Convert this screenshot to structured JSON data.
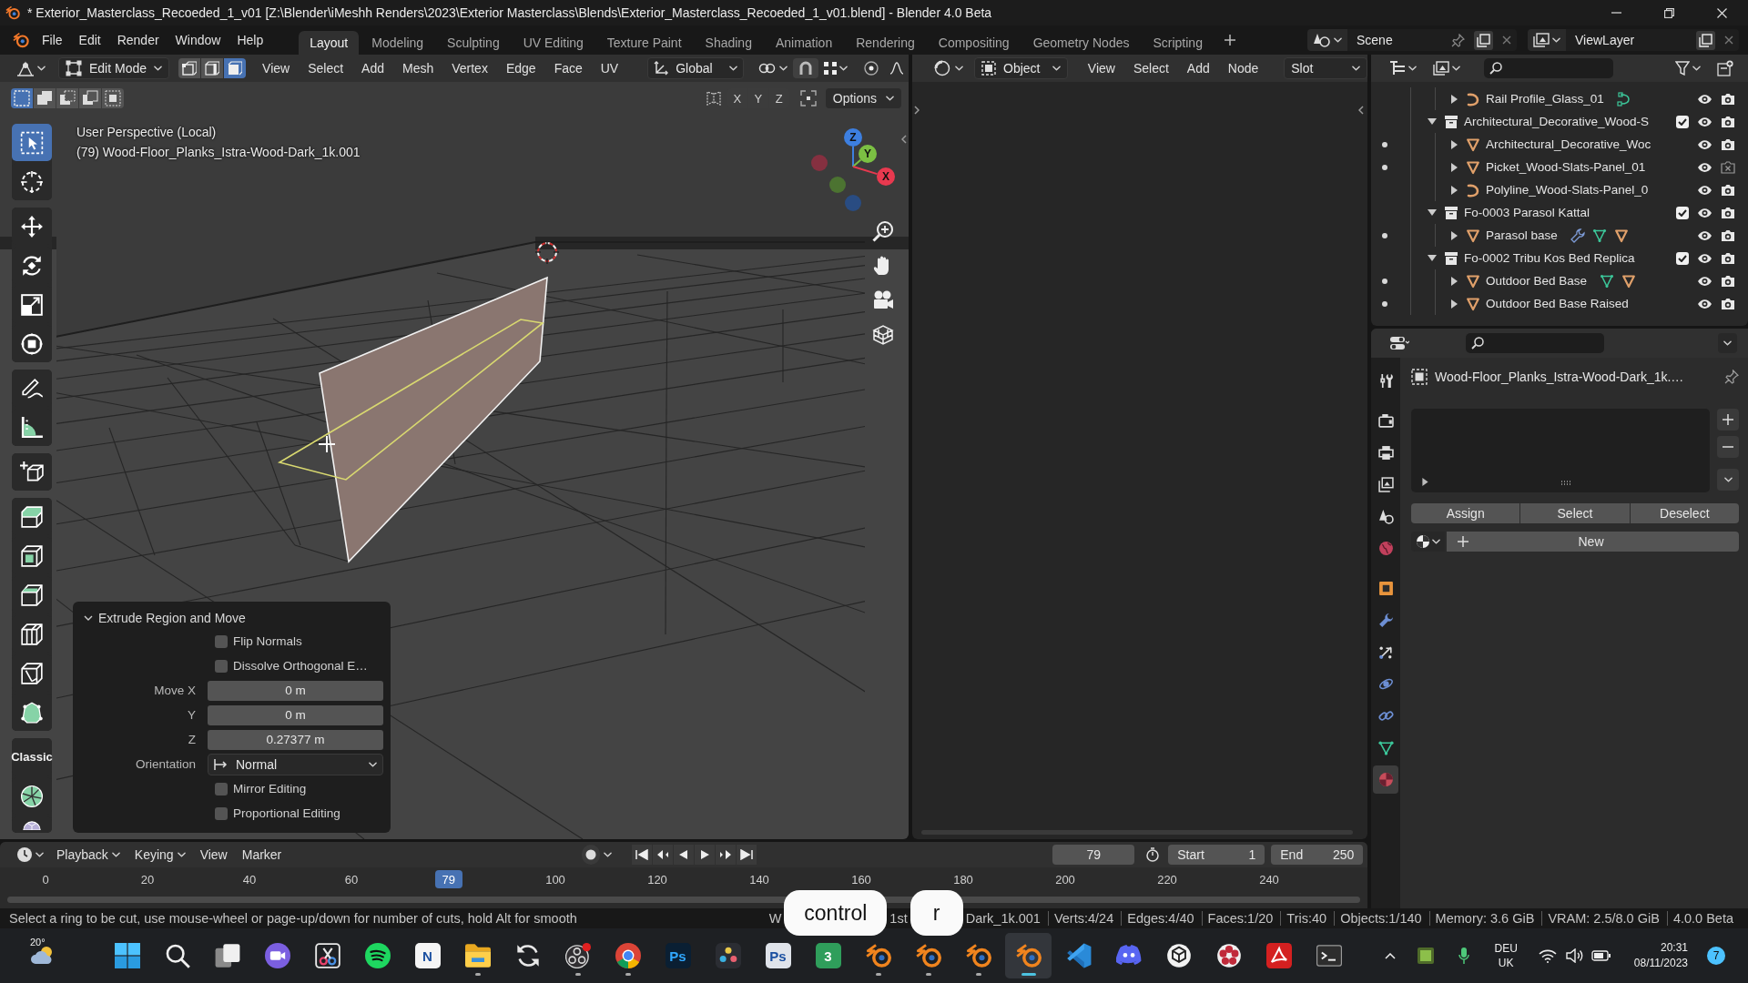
{
  "title_bar": {
    "title": "* Exterior_Masterclass_Recoeded_1_v01 [Z:\\Blender\\iMeshh Renders\\2023\\Exterior Masterclass\\Blends\\Exterior_Masterclass_Recoeded_1_v01.blend] - Blender 4.0 Beta"
  },
  "top_bar": {
    "menus": [
      "File",
      "Edit",
      "Render",
      "Window",
      "Help"
    ],
    "workspaces": [
      {
        "label": "Layout",
        "selected": true
      },
      {
        "label": "Modeling",
        "selected": false
      },
      {
        "label": "Sculpting",
        "selected": false
      },
      {
        "label": "UV Editing",
        "selected": false
      },
      {
        "label": "Texture Paint",
        "selected": false
      },
      {
        "label": "Shading",
        "selected": false
      },
      {
        "label": "Animation",
        "selected": false
      },
      {
        "label": "Rendering",
        "selected": false
      },
      {
        "label": "Compositing",
        "selected": false
      },
      {
        "label": "Geometry Nodes",
        "selected": false
      },
      {
        "label": "Scripting",
        "selected": false
      }
    ],
    "scene": "Scene",
    "view_layer": "ViewLayer"
  },
  "viewport": {
    "header": {
      "mode": "Edit Mode",
      "select_modes": [
        {
          "kind": "vertex",
          "selected": false
        },
        {
          "kind": "edge",
          "selected": false
        },
        {
          "kind": "face",
          "selected": true
        }
      ],
      "menus": [
        "View",
        "Select",
        "Add",
        "Mesh",
        "Vertex",
        "Edge",
        "Face",
        "UV"
      ],
      "orientation": "Global"
    },
    "tool_settings": {
      "box_modes": [
        {
          "kind": "set",
          "selected": true
        },
        {
          "kind": "extend",
          "selected": false
        },
        {
          "kind": "subtract",
          "selected": false
        },
        {
          "kind": "difference",
          "selected": false
        },
        {
          "kind": "intersect",
          "selected": false
        }
      ],
      "mirror_axes": [
        "X",
        "Y",
        "Z"
      ],
      "options": "Options"
    },
    "info": [
      "User Perspective (Local)",
      "(79) Wood-Floor_Planks_Istra-Wood-Dark_1k.001"
    ],
    "tool_groups": [
      [
        {
          "kind": "select",
          "selected": true
        },
        {
          "kind": "cursor",
          "selected": false
        }
      ],
      [
        {
          "kind": "move",
          "selected": false
        },
        {
          "kind": "rotate",
          "selected": false
        },
        {
          "kind": "scale",
          "selected": false
        },
        {
          "kind": "transform",
          "selected": false
        }
      ],
      [
        {
          "kind": "annotate",
          "selected": false
        },
        {
          "kind": "measure",
          "selected": false
        }
      ],
      [
        {
          "kind": "add_cube",
          "selected": false
        }
      ],
      [
        {
          "kind": "extrude",
          "selected": false
        },
        {
          "kind": "inset",
          "selected": false
        },
        {
          "kind": "bevel",
          "selected": false
        },
        {
          "kind": "loop_cut",
          "selected": false
        },
        {
          "kind": "knife",
          "selected": false
        },
        {
          "kind": "poly_build",
          "selected": false
        }
      ],
      [
        {
          "kind": "fast_loop",
          "label": "Classic",
          "selected": false
        },
        {
          "kind": "spin",
          "selected": false
        },
        {
          "kind": "smooth",
          "selected": false
        }
      ]
    ],
    "gizmo": [
      {
        "kind": "z",
        "label": "Z"
      },
      {
        "kind": "y",
        "label": "Y"
      },
      {
        "kind": "x",
        "label": "X"
      }
    ],
    "operator_panel": {
      "title": "Extrude Region and Move",
      "expanded": true,
      "fields": [
        {
          "kind": "checkbox",
          "label": "Flip Normals",
          "checked": false
        },
        {
          "kind": "checkbox",
          "label": "Dissolve Orthogonal E…",
          "checked": false
        },
        {
          "kind": "number",
          "label": "Move X",
          "value": "0 m"
        },
        {
          "kind": "number",
          "label": "Y",
          "value": "0 m"
        },
        {
          "kind": "number",
          "label": "Z",
          "value": "0.27377 m"
        },
        {
          "kind": "dropdown",
          "label": "Orientation",
          "value": "Normal"
        },
        {
          "kind": "checkbox",
          "label": "Mirror Editing",
          "checked": false
        },
        {
          "kind": "checkbox",
          "label": "Proportional Editing",
          "checked": false
        }
      ]
    }
  },
  "shader_editor": {
    "object_type": "Object",
    "menus": [
      "View",
      "Select",
      "Add",
      "Node"
    ],
    "slot": "Slot"
  },
  "outliner": {
    "tree": [
      {
        "kind": "continued",
        "children": [
          {
            "kind": "curve",
            "name": "Rail Profile_Glass_01",
            "expanded": false,
            "mode_dot": false,
            "visible": true,
            "render": true,
            "extras": [
              {
                "kind": "curve_data"
              }
            ]
          }
        ]
      },
      {
        "kind": "collection",
        "name": "Architectural_Decorative_Wood-S",
        "expanded": true,
        "checked": true,
        "visible": true,
        "render": true,
        "children": [
          {
            "kind": "mesh",
            "name": "Architectural_Decorative_Woc",
            "expanded": false,
            "mode_dot": true,
            "visible": true,
            "render": true
          },
          {
            "kind": "mesh",
            "name": "Picket_Wood-Slats-Panel_01",
            "expanded": false,
            "mode_dot": true,
            "visible": true,
            "render": false
          },
          {
            "kind": "curve",
            "name": "Polyline_Wood-Slats-Panel_0",
            "expanded": false,
            "mode_dot": false,
            "visible": true,
            "render": true
          }
        ]
      },
      {
        "kind": "collection",
        "name": "Fo-0003 Parasol Kattal",
        "expanded": true,
        "checked": true,
        "visible": true,
        "render": true,
        "children": [
          {
            "kind": "mesh",
            "name": "Parasol base",
            "expanded": false,
            "mode_dot": true,
            "visible": true,
            "render": true,
            "extras": [
              {
                "kind": "modifier"
              },
              {
                "kind": "mesh_data"
              },
              {
                "kind": "material"
              }
            ]
          }
        ]
      },
      {
        "kind": "collection",
        "name": "Fo-0002 Tribu Kos Bed Replica",
        "expanded": true,
        "checked": true,
        "visible": true,
        "render": true,
        "children": [
          {
            "kind": "mesh",
            "name": "Outdoor Bed Base",
            "expanded": false,
            "mode_dot": true,
            "visible": true,
            "render": true,
            "extras": [
              {
                "kind": "mesh_data"
              },
              {
                "kind": "material"
              }
            ]
          },
          {
            "kind": "mesh",
            "name": "Outdoor Bed Base Raised",
            "expanded": false,
            "mode_dot": true,
            "visible": true,
            "render": true
          }
        ]
      }
    ]
  },
  "properties": {
    "tabs": [
      {
        "kind": "tool",
        "selected": false
      },
      {
        "kind": "render",
        "selected": false
      },
      {
        "kind": "output",
        "selected": false
      },
      {
        "kind": "view_layer",
        "selected": false
      },
      {
        "kind": "scene",
        "selected": false
      },
      {
        "kind": "world",
        "selected": false
      },
      {
        "kind": "object",
        "selected": false
      },
      {
        "kind": "modifiers",
        "selected": false
      },
      {
        "kind": "particles",
        "selected": false
      },
      {
        "kind": "physics",
        "selected": false
      },
      {
        "kind": "constraints",
        "selected": false
      },
      {
        "kind": "data",
        "selected": false
      },
      {
        "kind": "material",
        "selected": true
      }
    ],
    "object_name": "Wood-Floor_Planks_Istra-Wood-Dark_1k.…",
    "slot_buttons": [
      "Assign",
      "Select",
      "Deselect"
    ],
    "new_material": "New"
  },
  "timeline": {
    "menus": [
      {
        "label": "Playback",
        "dropdown": true
      },
      {
        "label": "Keying",
        "dropdown": true
      },
      {
        "label": "View",
        "dropdown": false
      },
      {
        "label": "Marker",
        "dropdown": false
      }
    ],
    "current_frame": "79",
    "start": {
      "label": "Start",
      "value": "1"
    },
    "end": {
      "label": "End",
      "value": "250"
    },
    "ticks": [
      "0",
      "20",
      "40",
      "60",
      "100",
      "120",
      "140",
      "160",
      "180",
      "200",
      "220",
      "240"
    ],
    "playhead": {
      "label": "79",
      "level": 0.328
    }
  },
  "status_bar": {
    "hint": "Select a ring to be cut, use mouse-wheel or page-up/down for number of cuts, hold Alt for smooth",
    "items": [
      {
        "kind": "fragment",
        "text": "W"
      },
      {
        "kind": "key",
        "text": "control"
      },
      {
        "kind": "fragment",
        "text": "1st"
      },
      {
        "kind": "key",
        "text": "r"
      },
      {
        "kind": "fragment",
        "text": "Dark_1k.001"
      },
      {
        "kind": "stat",
        "text": "Verts:4/24"
      },
      {
        "kind": "stat",
        "text": "Edges:4/40"
      },
      {
        "kind": "stat",
        "text": "Faces:1/20"
      },
      {
        "kind": "stat",
        "text": "Tris:40"
      },
      {
        "kind": "stat",
        "text": "Objects:1/140"
      },
      {
        "kind": "stat",
        "text": "Memory: 3.6 GiB"
      },
      {
        "kind": "stat",
        "text": "VRAM: 2.5/8.0 GiB"
      },
      {
        "kind": "stat",
        "text": "4.0.0 Beta"
      }
    ]
  },
  "taskbar": {
    "weather": "20°",
    "apps": [
      {
        "kind": "start",
        "running": false,
        "selected": false
      },
      {
        "kind": "search",
        "running": false,
        "selected": false
      },
      {
        "kind": "taskview",
        "running": false,
        "selected": false
      },
      {
        "kind": "video",
        "running": false,
        "selected": false
      },
      {
        "kind": "snip",
        "running": false,
        "selected": false
      },
      {
        "kind": "music",
        "running": false,
        "selected": false
      },
      {
        "kind": "tile",
        "label": "N",
        "color": "#f4f4f4",
        "running": false,
        "selected": false
      },
      {
        "kind": "folder",
        "running": true,
        "selected": false
      },
      {
        "kind": "sync",
        "running": false,
        "selected": false
      },
      {
        "kind": "record",
        "running": true,
        "selected": false
      },
      {
        "kind": "browser",
        "running": true,
        "selected": false
      },
      {
        "kind": "tile",
        "label": "Ps",
        "color": "#0a1f33",
        "running": false,
        "selected": false
      },
      {
        "kind": "dots",
        "running": false,
        "selected": false
      },
      {
        "kind": "tile",
        "label": "Ps",
        "color": "#dfe3ea",
        "running": false,
        "selected": false
      },
      {
        "kind": "tile",
        "label": "3",
        "color": "#2f9e5b",
        "running": false,
        "selected": false
      },
      {
        "kind": "orbit",
        "running": true,
        "selected": false
      },
      {
        "kind": "orbit",
        "running": true,
        "selected": false
      },
      {
        "kind": "orbit",
        "running": true,
        "selected": false
      },
      {
        "kind": "orbit",
        "running": true,
        "selected": true
      },
      {
        "kind": "ribbon",
        "running": false,
        "selected": false
      },
      {
        "kind": "controller",
        "running": false,
        "selected": false
      },
      {
        "kind": "knot",
        "running": false,
        "selected": false
      },
      {
        "kind": "flower",
        "running": false,
        "selected": false
      },
      {
        "kind": "pdf",
        "running": false,
        "selected": false
      },
      {
        "kind": "terminal",
        "running": false,
        "selected": false
      }
    ],
    "language": [
      "DEU",
      "UK"
    ],
    "time": "20:31",
    "date": "08/11/2023",
    "notifications": "7"
  }
}
